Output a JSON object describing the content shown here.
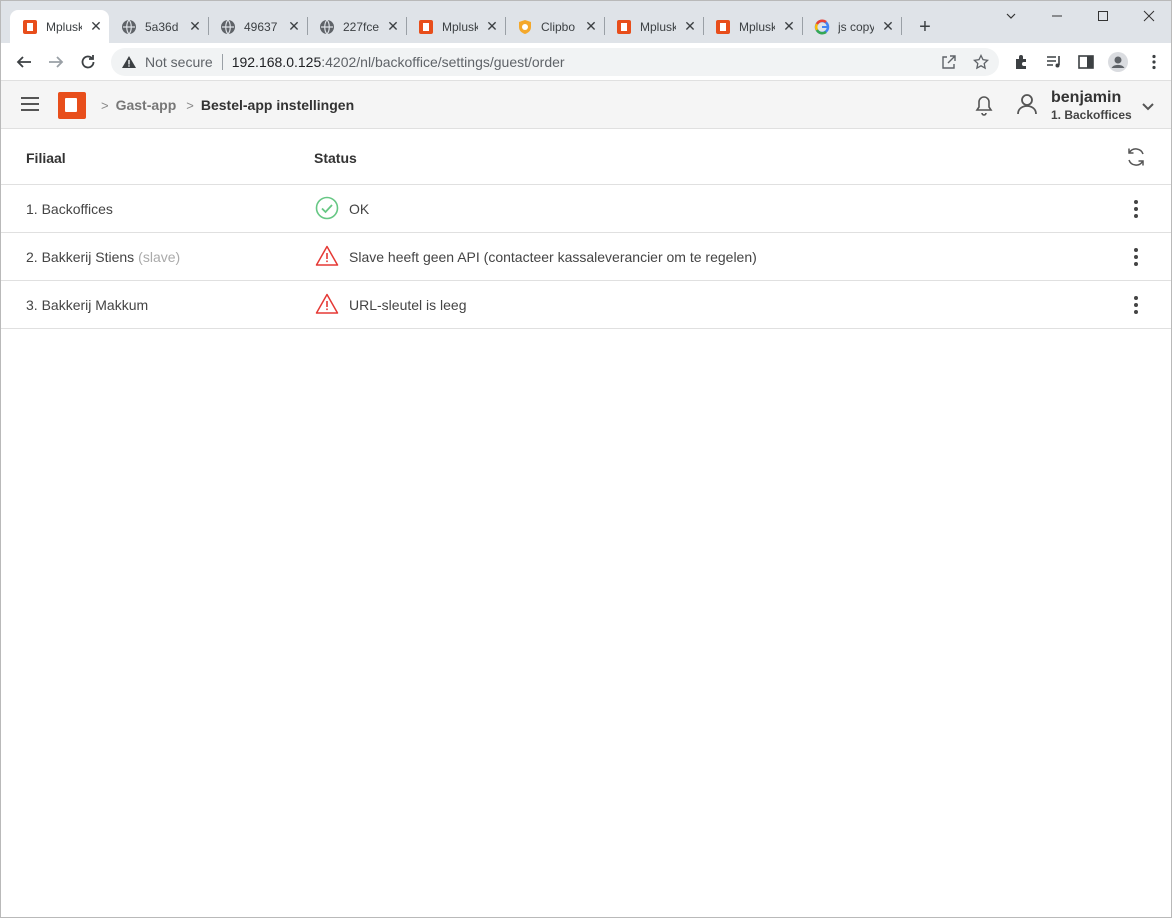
{
  "browser": {
    "tabs": [
      {
        "title": "Mplusk",
        "favicon": "mplus-logo-icon",
        "active": true
      },
      {
        "title": "5a36d",
        "favicon": "globe-icon",
        "active": false
      },
      {
        "title": "49637",
        "favicon": "globe-icon",
        "active": false
      },
      {
        "title": "227fce",
        "favicon": "globe-icon",
        "active": false
      },
      {
        "title": "Mplusk",
        "favicon": "mplus-logo-icon",
        "active": false
      },
      {
        "title": "Clipbo",
        "favicon": "shield-extension-icon",
        "active": false
      },
      {
        "title": "Mplusk",
        "favicon": "mplus-logo-icon",
        "active": false
      },
      {
        "title": "Mplusk",
        "favicon": "mplus-logo-icon",
        "active": false
      },
      {
        "title": "js copy",
        "favicon": "google-icon",
        "active": false
      }
    ],
    "security_label": "Not secure",
    "url_host": "192.168.0.125",
    "url_rest": ":4202/nl/backoffice/settings/guest/order"
  },
  "app": {
    "accent_color": "#e84e1b",
    "breadcrumbs": [
      "Gast-app",
      "Bestel-app instellingen"
    ],
    "user_name": "benjamin",
    "user_branch": "1. Backoffices"
  },
  "table": {
    "headers": {
      "branch": "Filiaal",
      "status": "Status"
    },
    "rows": [
      {
        "branch": "1. Backoffices",
        "suffix": "",
        "status": "OK",
        "status_icon": "check-circle-icon",
        "status_color": "#4caf50"
      },
      {
        "branch": "2. Bakkerij Stiens",
        "suffix": "(slave)",
        "status": "Slave heeft geen API (contacteer kassaleverancier om te regelen)",
        "status_icon": "warning-triangle-icon",
        "status_color": "#e53935"
      },
      {
        "branch": "3. Bakkerij Makkum",
        "suffix": "",
        "status": "URL-sleutel is leeg",
        "status_icon": "warning-triangle-icon",
        "status_color": "#e53935"
      }
    ]
  }
}
